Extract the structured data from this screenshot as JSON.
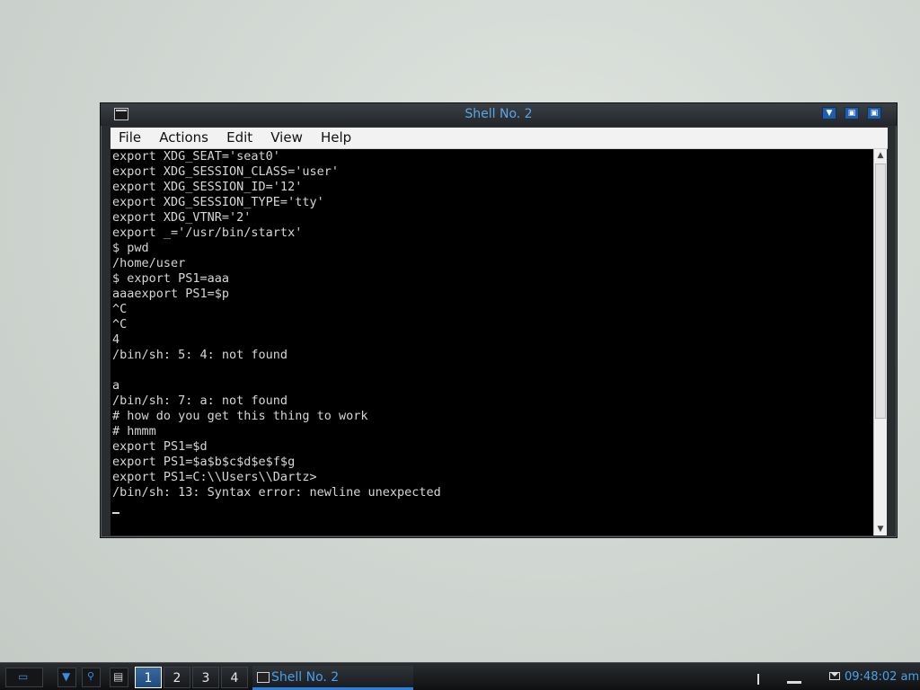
{
  "window": {
    "title": "Shell No. 2",
    "buttons": [
      "▼",
      "▣",
      "▣"
    ]
  },
  "menubar": {
    "items": [
      "File",
      "Actions",
      "Edit",
      "View",
      "Help"
    ]
  },
  "terminal": {
    "lines": [
      "export XDG_SEAT='seat0'",
      "export XDG_SESSION_CLASS='user'",
      "export XDG_SESSION_ID='12'",
      "export XDG_SESSION_TYPE='tty'",
      "export XDG_VTNR='2'",
      "export _='/usr/bin/startx'",
      "$ pwd",
      "/home/user",
      "$ export PS1=aaa",
      "aaaexport PS1=$p",
      "^C",
      "^C",
      "4",
      "/bin/sh: 5: 4: not found",
      "",
      "a",
      "/bin/sh: 7: a: not found",
      "# how do you get this thing to work",
      "# hmmm",
      "export PS1=$d",
      "export PS1=$a$b$c$d$e$f$g",
      "export PS1=C:\\\\Users\\\\Dartz>",
      "/bin/sh: 13: Syntax error: newline unexpected",
      ""
    ]
  },
  "taskbar": {
    "desktops": [
      "1",
      "2",
      "3",
      "4"
    ],
    "active_desktop": "1",
    "task_label": "Shell No. 2",
    "clock": "09:48:02  am"
  },
  "colors": {
    "accent": "#4aa0ea",
    "terminal_bg": "#000000",
    "terminal_fg": "#d6d6d6"
  }
}
